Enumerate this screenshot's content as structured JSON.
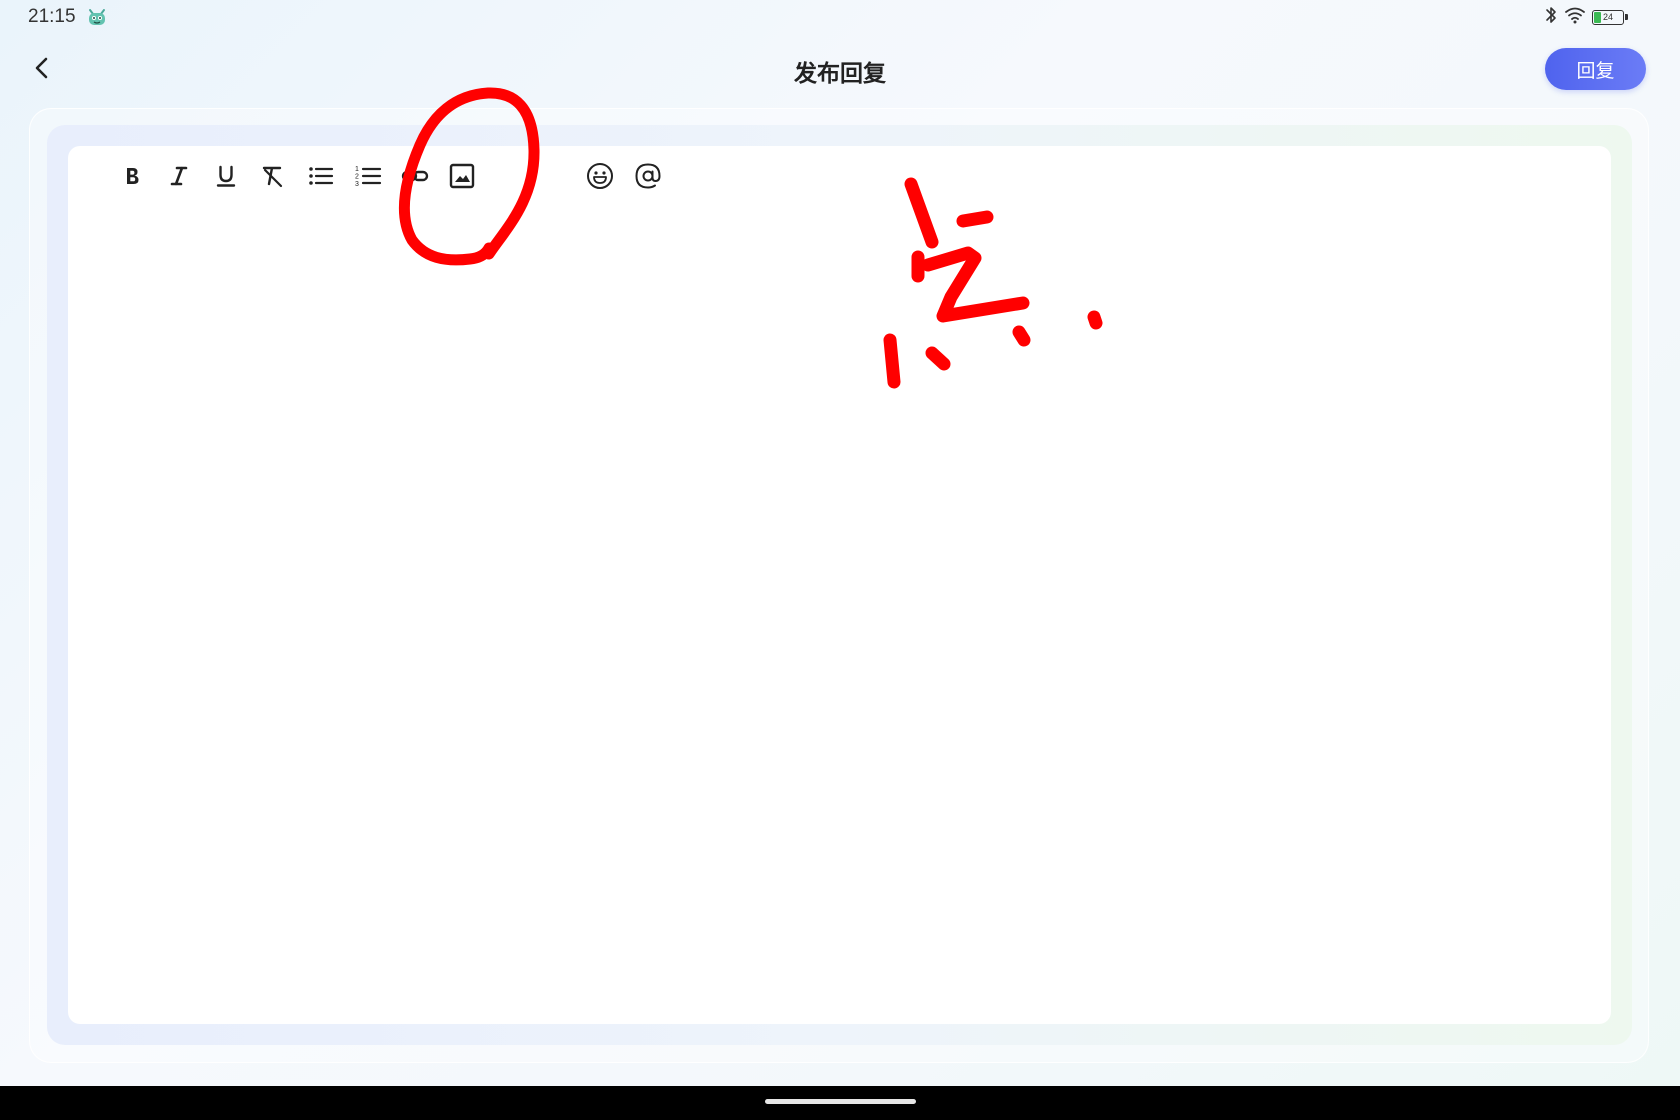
{
  "status_bar": {
    "time": "21:15",
    "app_icon": "robot-face-icon",
    "icons": [
      "bluetooth-icon",
      "wifi-icon",
      "battery-icon"
    ],
    "battery_level": "24",
    "battery_fraction": 0.24
  },
  "header": {
    "back_icon": "chevron-left-icon",
    "title": "发布回复",
    "reply_label": "回复"
  },
  "editor": {
    "toolbar": [
      {
        "name": "bold",
        "icon": "bold-icon"
      },
      {
        "name": "italic",
        "icon": "italic-icon"
      },
      {
        "name": "underline",
        "icon": "underline-icon"
      },
      {
        "name": "clear-format",
        "icon": "clear-format-icon"
      },
      {
        "name": "bulleted-list",
        "icon": "bulleted-list-icon"
      },
      {
        "name": "numbered-list",
        "icon": "numbered-list-icon"
      },
      {
        "name": "link",
        "icon": "link-icon"
      },
      {
        "name": "image",
        "icon": "image-icon"
      },
      {
        "name": "emoji",
        "icon": "emoji-icon"
      },
      {
        "name": "mention",
        "icon": "at-sign-icon"
      }
    ],
    "content": ""
  },
  "annotation": {
    "color": "#ff0000",
    "handwritten_text": "点",
    "target": "image-button"
  },
  "colors": {
    "accent": "#5063ee",
    "annotation": "#ff0000",
    "battery": "#3cba54"
  }
}
